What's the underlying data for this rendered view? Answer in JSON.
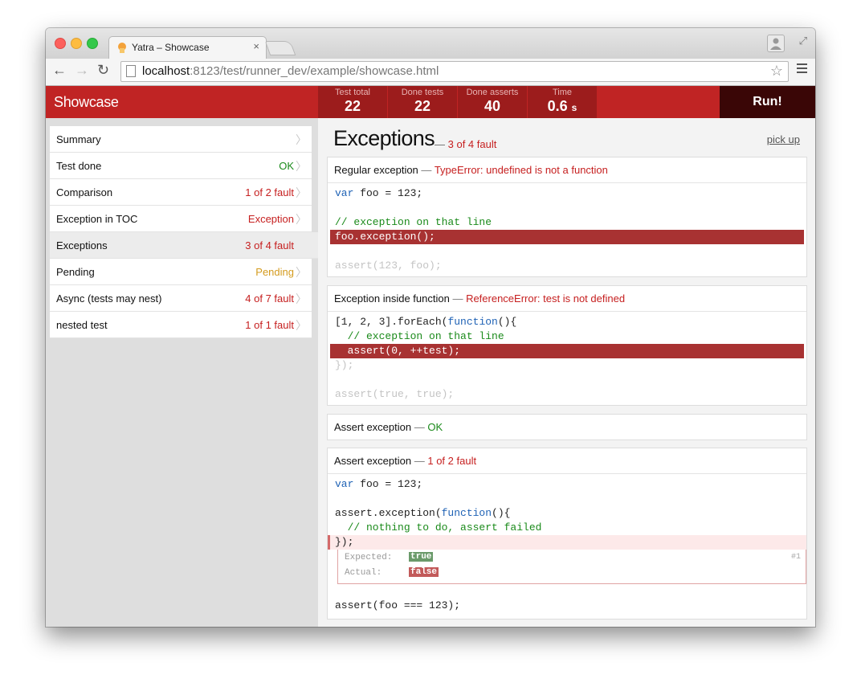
{
  "browser": {
    "tab_title": "Yatra – Showcase",
    "tab_close": "×",
    "url_host": "localhost",
    "url_rest": ":8123/test/runner_dev/example/showcase.html"
  },
  "app": {
    "title": "Showcase",
    "stats": [
      {
        "label": "Test total",
        "value": "22"
      },
      {
        "label": "Done tests",
        "value": "22"
      },
      {
        "label": "Done asserts",
        "value": "40"
      },
      {
        "label": "Time",
        "value": "0.6",
        "unit": "s"
      }
    ],
    "run_label": "Run!"
  },
  "sidebar": {
    "items": [
      {
        "label": "Summary",
        "status": ""
      },
      {
        "label": "Test done",
        "status": "OK"
      },
      {
        "label": "Comparison",
        "status": "1 of 2 fault"
      },
      {
        "label": "Exception in TOC",
        "status": "Exception"
      },
      {
        "label": "Exceptions",
        "status": "3 of 4 fault"
      },
      {
        "label": "Pending",
        "status": "Pending"
      },
      {
        "label": "Async (tests may nest)",
        "status": "4 of 7 fault"
      },
      {
        "label": "nested test",
        "status": "1 of 1 fault"
      }
    ]
  },
  "main": {
    "title": "Exceptions",
    "dash": "—",
    "summary": "3 of 4 fault",
    "pickup": "pick up",
    "cards": [
      {
        "title": "Regular exception",
        "status": "TypeError: undefined is not a function"
      },
      {
        "title": "Exception inside function",
        "status": "ReferenceError: test is not defined"
      },
      {
        "title": "Assert exception",
        "status": "OK"
      },
      {
        "title": "Assert exception",
        "status": "1 of 2 fault"
      }
    ],
    "code1": {
      "l1_kw": "var",
      "l1_rest": " foo = 123;",
      "l3": "// exception on that line",
      "l4": "foo.exception();",
      "l6": "assert(123, foo);"
    },
    "code2": {
      "l1a": "[1, 2, 3].forEach(",
      "l1kw": "function",
      "l1b": "(){",
      "l2": "  // exception on that line",
      "l3": "  assert(0, ++test);",
      "l4": "});",
      "l6": "assert(true, true);"
    },
    "code4": {
      "l1_kw": "var",
      "l1_rest": " foo = 123;",
      "l3a": "assert.exception(",
      "l3kw": "function",
      "l3b": "(){",
      "l4": "  // nothing to do, assert failed",
      "l5": "});",
      "expected_label": "Expected:",
      "expected_val": "true",
      "actual_label": "Actual:",
      "actual_val": "false",
      "assert_num": "#1",
      "l7": "assert(foo === 123);"
    }
  }
}
